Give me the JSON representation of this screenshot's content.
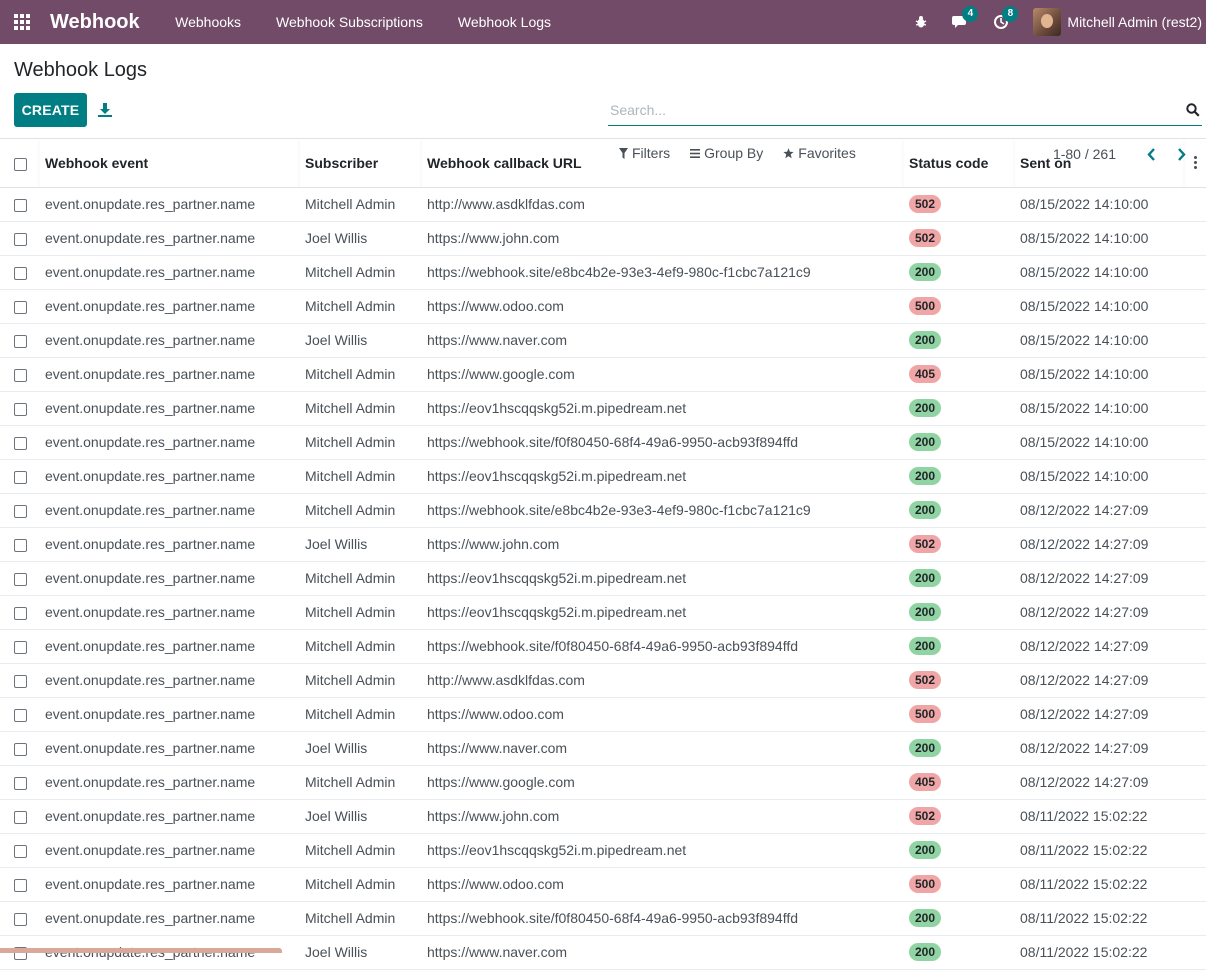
{
  "navbar": {
    "brand": "Webhook",
    "menu": [
      "Webhooks",
      "Webhook Subscriptions",
      "Webhook Logs"
    ],
    "messages_badge": "4",
    "activities_badge": "8",
    "user_name": "Mitchell Admin (rest2)",
    "bg_color": "#714b67"
  },
  "control_panel": {
    "title": "Webhook Logs",
    "create_label": "CREATE",
    "search_placeholder": "Search...",
    "filters_label": "Filters",
    "group_by_label": "Group By",
    "favorites_label": "Favorites",
    "pager_value": "1-80 / 261"
  },
  "table": {
    "headers": [
      "Webhook event",
      "Subscriber",
      "Webhook callback URL",
      "Status code",
      "Sent on"
    ],
    "rows": [
      {
        "event": "event.onupdate.res_partner.name",
        "subscriber": "Mitchell Admin",
        "url": "http://www.asdklfdas.com",
        "status": "502",
        "sent": "08/15/2022 14:10:00"
      },
      {
        "event": "event.onupdate.res_partner.name",
        "subscriber": "Joel Willis",
        "url": "https://www.john.com",
        "status": "502",
        "sent": "08/15/2022 14:10:00"
      },
      {
        "event": "event.onupdate.res_partner.name",
        "subscriber": "Mitchell Admin",
        "url": "https://webhook.site/e8bc4b2e-93e3-4ef9-980c-f1cbc7a121c9",
        "status": "200",
        "sent": "08/15/2022 14:10:00"
      },
      {
        "event": "event.onupdate.res_partner.name",
        "subscriber": "Mitchell Admin",
        "url": "https://www.odoo.com",
        "status": "500",
        "sent": "08/15/2022 14:10:00"
      },
      {
        "event": "event.onupdate.res_partner.name",
        "subscriber": "Joel Willis",
        "url": "https://www.naver.com",
        "status": "200",
        "sent": "08/15/2022 14:10:00"
      },
      {
        "event": "event.onupdate.res_partner.name",
        "subscriber": "Mitchell Admin",
        "url": "https://www.google.com",
        "status": "405",
        "sent": "08/15/2022 14:10:00"
      },
      {
        "event": "event.onupdate.res_partner.name",
        "subscriber": "Mitchell Admin",
        "url": "https://eov1hscqqskg52i.m.pipedream.net",
        "status": "200",
        "sent": "08/15/2022 14:10:00"
      },
      {
        "event": "event.onupdate.res_partner.name",
        "subscriber": "Mitchell Admin",
        "url": "https://webhook.site/f0f80450-68f4-49a6-9950-acb93f894ffd",
        "status": "200",
        "sent": "08/15/2022 14:10:00"
      },
      {
        "event": "event.onupdate.res_partner.name",
        "subscriber": "Mitchell Admin",
        "url": "https://eov1hscqqskg52i.m.pipedream.net",
        "status": "200",
        "sent": "08/15/2022 14:10:00"
      },
      {
        "event": "event.onupdate.res_partner.name",
        "subscriber": "Mitchell Admin",
        "url": "https://webhook.site/e8bc4b2e-93e3-4ef9-980c-f1cbc7a121c9",
        "status": "200",
        "sent": "08/12/2022 14:27:09"
      },
      {
        "event": "event.onupdate.res_partner.name",
        "subscriber": "Joel Willis",
        "url": "https://www.john.com",
        "status": "502",
        "sent": "08/12/2022 14:27:09"
      },
      {
        "event": "event.onupdate.res_partner.name",
        "subscriber": "Mitchell Admin",
        "url": "https://eov1hscqqskg52i.m.pipedream.net",
        "status": "200",
        "sent": "08/12/2022 14:27:09"
      },
      {
        "event": "event.onupdate.res_partner.name",
        "subscriber": "Mitchell Admin",
        "url": "https://eov1hscqqskg52i.m.pipedream.net",
        "status": "200",
        "sent": "08/12/2022 14:27:09"
      },
      {
        "event": "event.onupdate.res_partner.name",
        "subscriber": "Mitchell Admin",
        "url": "https://webhook.site/f0f80450-68f4-49a6-9950-acb93f894ffd",
        "status": "200",
        "sent": "08/12/2022 14:27:09"
      },
      {
        "event": "event.onupdate.res_partner.name",
        "subscriber": "Mitchell Admin",
        "url": "http://www.asdklfdas.com",
        "status": "502",
        "sent": "08/12/2022 14:27:09"
      },
      {
        "event": "event.onupdate.res_partner.name",
        "subscriber": "Mitchell Admin",
        "url": "https://www.odoo.com",
        "status": "500",
        "sent": "08/12/2022 14:27:09"
      },
      {
        "event": "event.onupdate.res_partner.name",
        "subscriber": "Joel Willis",
        "url": "https://www.naver.com",
        "status": "200",
        "sent": "08/12/2022 14:27:09"
      },
      {
        "event": "event.onupdate.res_partner.name",
        "subscriber": "Mitchell Admin",
        "url": "https://www.google.com",
        "status": "405",
        "sent": "08/12/2022 14:27:09"
      },
      {
        "event": "event.onupdate.res_partner.name",
        "subscriber": "Joel Willis",
        "url": "https://www.john.com",
        "status": "502",
        "sent": "08/11/2022 15:02:22"
      },
      {
        "event": "event.onupdate.res_partner.name",
        "subscriber": "Mitchell Admin",
        "url": "https://eov1hscqqskg52i.m.pipedream.net",
        "status": "200",
        "sent": "08/11/2022 15:02:22"
      },
      {
        "event": "event.onupdate.res_partner.name",
        "subscriber": "Mitchell Admin",
        "url": "https://www.odoo.com",
        "status": "500",
        "sent": "08/11/2022 15:02:22"
      },
      {
        "event": "event.onupdate.res_partner.name",
        "subscriber": "Mitchell Admin",
        "url": "https://webhook.site/f0f80450-68f4-49a6-9950-acb93f894ffd",
        "status": "200",
        "sent": "08/11/2022 15:02:22"
      },
      {
        "event": "event.onupdate.res_partner.name",
        "subscriber": "Joel Willis",
        "url": "https://www.naver.com",
        "status": "200",
        "sent": "08/11/2022 15:02:22"
      }
    ]
  },
  "status_colors": {
    "success": "#8fd4a2",
    "error": "#f0a6a6"
  }
}
